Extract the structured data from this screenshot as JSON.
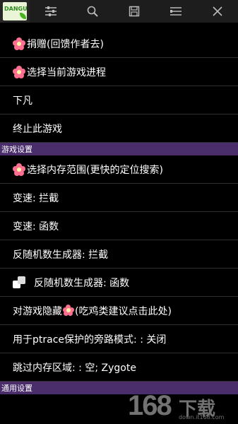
{
  "toolbar": {
    "logo_text": "DANGU",
    "buttons": [
      {
        "icon": "sliders-icon"
      },
      {
        "icon": "search-icon"
      },
      {
        "icon": "save-icon"
      },
      {
        "icon": "list-icon"
      },
      {
        "icon": "close-icon"
      }
    ]
  },
  "menu": {
    "items": [
      {
        "label": "捐赠(回馈作者去)",
        "icon": "flower-icon"
      },
      {
        "label": "选择当前游戏进程",
        "icon": "flower-icon"
      },
      {
        "label": "下凡"
      },
      {
        "label": "终止此游戏"
      }
    ],
    "section_game": "游戏设置",
    "game_items": [
      {
        "label": "选择内存范围(更快的定位搜索)",
        "icon": "flower-icon"
      },
      {
        "label": "变速: 拦截"
      },
      {
        "label": "变速: 函数"
      },
      {
        "label": "反随机数生成器: 拦截"
      },
      {
        "label": "反随机数生成器: 函数",
        "icon": "dice-icon"
      },
      {
        "label_pre": "对游戏隐藏",
        "label_post": "(吃鸡类建议点击此处)",
        "icon": "flower-icon"
      },
      {
        "label": "用于ptrace保护的旁路模式: : 关闭"
      },
      {
        "label": "跳过内存区域: : 空; Zygote"
      }
    ],
    "section_general": "通用设置"
  },
  "watermark": {
    "number": "168",
    "text": "下载",
    "url": "down.it168.com"
  },
  "colors": {
    "section_bg": "#4a2e6b",
    "background": "#000000",
    "toolbar_bg": "#1d1d1d"
  }
}
